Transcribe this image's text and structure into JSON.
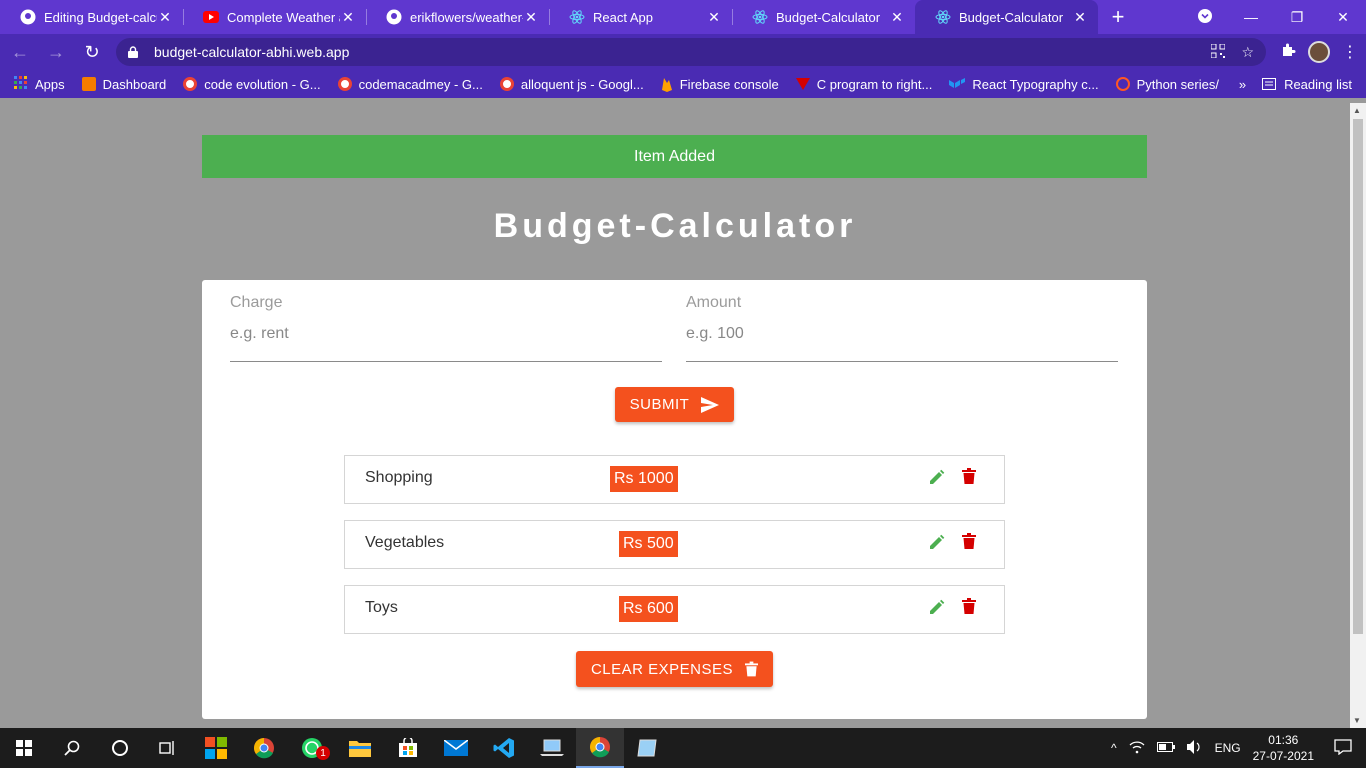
{
  "browser": {
    "tabs": [
      {
        "title": "Editing Budget-calcula",
        "icon": "github-icon",
        "active": false
      },
      {
        "title": "Complete Weather app",
        "icon": "youtube-icon",
        "active": false
      },
      {
        "title": "erikflowers/weather-ic",
        "icon": "github-icon",
        "active": false
      },
      {
        "title": "React App",
        "icon": "react-icon",
        "active": false
      },
      {
        "title": "Budget-Calculator",
        "icon": "react-icon",
        "active": false
      },
      {
        "title": "Budget-Calculator",
        "icon": "react-icon",
        "active": true
      }
    ],
    "url": "budget-calculator-abhi.web.app",
    "bookmarks": [
      {
        "label": "Apps",
        "color": "#4285f4"
      },
      {
        "label": "Dashboard",
        "color": "#f57c00"
      },
      {
        "label": "code evolution - G...",
        "color": "#ea4335"
      },
      {
        "label": "codemacadmey - G...",
        "color": "#ea4335"
      },
      {
        "label": "alloquent js - Googl...",
        "color": "#ea4335"
      },
      {
        "label": "Firebase console",
        "color": "#ffa000"
      },
      {
        "label": "C program to right...",
        "color": "#d50000"
      },
      {
        "label": "React Typography c...",
        "color": "#2196f3"
      },
      {
        "label": "Python series/",
        "color": "#ff5722"
      }
    ],
    "bookmarks_overflow": "»",
    "reading_list": "Reading list"
  },
  "app": {
    "alert": "Item Added",
    "title": "Budget-Calculator",
    "charge": {
      "label": "Charge",
      "placeholder": "e.g. rent"
    },
    "amount": {
      "label": "Amount",
      "placeholder": "e.g. 100"
    },
    "submit_label": "SUBMIT",
    "expenses": [
      {
        "name": "Shopping",
        "amount": "Rs 1000"
      },
      {
        "name": "Vegetables",
        "amount": "Rs 500"
      },
      {
        "name": "Toys",
        "amount": "Rs 600"
      }
    ],
    "clear_label": "CLEAR EXPENSES"
  },
  "taskbar": {
    "whatsapp_badge": "1",
    "language": "ENG",
    "time": "01:36",
    "date": "27-07-2021"
  },
  "colors": {
    "accent": "#f4511e",
    "success": "#4caf50",
    "browser": "#4a2bb3"
  }
}
